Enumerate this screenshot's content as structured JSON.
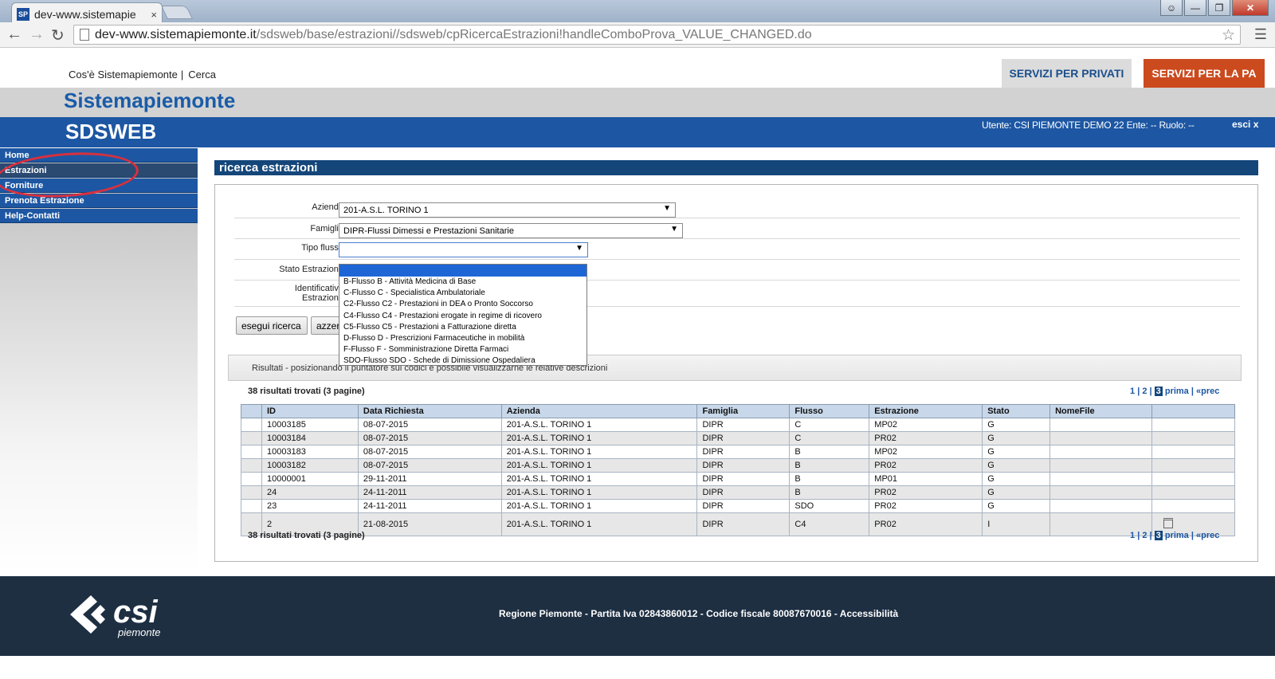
{
  "browser": {
    "tab_title": "dev-www.sistemapie",
    "favicon": "SP",
    "tab_close": "×",
    "url_host": "dev-www.sistemapiemonte.it",
    "url_path": "/sdsweb/base/estrazioni//sdsweb/cpRicercaEstrazioni!handleComboProva_VALUE_CHANGED.do"
  },
  "header": {
    "link_cose": "Cos'è Sistemapiemonte",
    "link_sep": "|",
    "link_cerca": "Cerca",
    "btn_privati": "SERVIZI PER PRIVATI",
    "btn_pa": "SERVIZI PER LA PA",
    "site_title": "Sistemapiemonte",
    "app_title": "SDSWEB",
    "user_info": "Utente: CSI PIEMONTE DEMO 22   Ente: --   Ruolo: --",
    "esci": "esci x"
  },
  "sidebar": {
    "items": [
      {
        "label": "Home"
      },
      {
        "label": "Estrazioni"
      },
      {
        "label": "Forniture"
      },
      {
        "label": "Prenota Estrazione"
      },
      {
        "label": "Help-Contatti"
      }
    ]
  },
  "main": {
    "section_title": "ricerca estrazioni",
    "form": {
      "azienda_label": "Azienda",
      "azienda_value": "201-A.S.L. TORINO 1",
      "famiglia_label": "Famiglia",
      "famiglia_value": "DIPR-Flussi Dimessi e Prestazioni Sanitarie",
      "tipo_flusso_label": "Tipo flusso",
      "tipo_flusso_value": "",
      "stato_label": "Stato Estrazione",
      "identificativo_label_1": "Identificativo",
      "identificativo_label_2": "Estrazione",
      "btn_search": "esegui ricerca",
      "btn_reset": "azzera"
    },
    "dropdown_options": [
      "B-Flusso B - Attività Medicina di Base",
      "C-Flusso C - Specialistica Ambulatoriale",
      "C2-Flusso C2 - Prestazioni in DEA o Pronto Soccorso",
      "C4-Flusso C4 - Prestazioni erogate in regime di ricovero",
      "C5-Flusso C5 - Prestazioni a Fatturazione diretta",
      "D-Flusso D - Prescrizioni Farmaceutiche in mobilità",
      "F-Flusso F - Somministrazione Diretta Farmaci",
      "SDO-Flusso SDO - Schede di Dimissione Ospedaliera"
    ],
    "results_note": "Risultati - posizionando il puntatore sui codici è possibile visualizzarne le relative descrizioni",
    "count_text": "38 risultati trovati (3 pagine)",
    "pager": {
      "p1": "1",
      "sep": "|",
      "p2": "2",
      "p3": "3",
      "prima": "prima",
      "prec": "«prec"
    },
    "table": {
      "columns": [
        "",
        "ID",
        "Data Richiesta",
        "Azienda",
        "Famiglia",
        "Flusso",
        "Estrazione",
        "Stato",
        "NomeFile",
        ""
      ],
      "rows": [
        [
          "10003185",
          "08-07-2015",
          "201-A.S.L. TORINO 1",
          "DIPR",
          "C",
          "MP02",
          "G",
          ""
        ],
        [
          "10003184",
          "08-07-2015",
          "201-A.S.L. TORINO 1",
          "DIPR",
          "C",
          "PR02",
          "G",
          ""
        ],
        [
          "10003183",
          "08-07-2015",
          "201-A.S.L. TORINO 1",
          "DIPR",
          "B",
          "MP02",
          "G",
          ""
        ],
        [
          "10003182",
          "08-07-2015",
          "201-A.S.L. TORINO 1",
          "DIPR",
          "B",
          "PR02",
          "G",
          ""
        ],
        [
          "10000001",
          "29-11-2011",
          "201-A.S.L. TORINO 1",
          "DIPR",
          "B",
          "MP01",
          "G",
          ""
        ],
        [
          "24",
          "24-11-2011",
          "201-A.S.L. TORINO 1",
          "DIPR",
          "B",
          "PR02",
          "G",
          ""
        ],
        [
          "23",
          "24-11-2011",
          "201-A.S.L. TORINO 1",
          "DIPR",
          "SDO",
          "PR02",
          "G",
          ""
        ],
        [
          "2",
          "21-08-2015",
          "201-A.S.L. TORINO 1",
          "DIPR",
          "C4",
          "PR02",
          "I",
          ""
        ]
      ]
    }
  },
  "footer": {
    "text": "Regione Piemonte - Partita Iva 02843860012 - Codice fiscale 80087670016 - Accessibilità",
    "logo_text": "csi",
    "logo_sub": "piemonte"
  },
  "colors": {
    "brand_blue": "#1d57a3",
    "dark_blue": "#14467a",
    "orange": "#cb4a1e",
    "footer_bg": "#1e2f42",
    "highlight_red": "#d9303d"
  }
}
